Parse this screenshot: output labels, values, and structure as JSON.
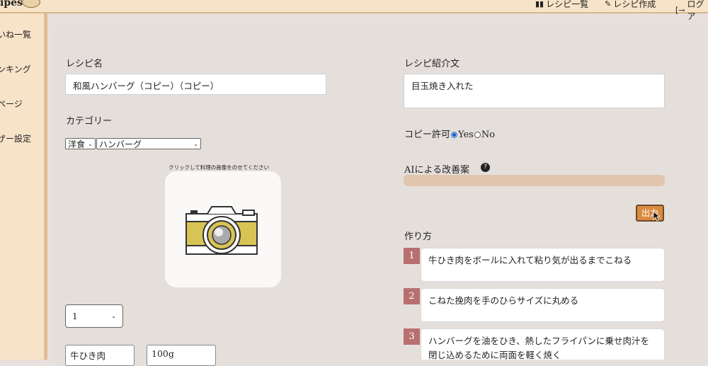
{
  "header": {
    "logo_text": "ipes",
    "nav": [
      {
        "label": "レシピ一覧"
      },
      {
        "label": "レシピ作成"
      },
      {
        "label": "ログア"
      }
    ]
  },
  "sidebar": {
    "items": [
      {
        "label": "いね一覧"
      },
      {
        "label": "ンキング"
      },
      {
        "label": "ページ"
      },
      {
        "label": "ザー設定"
      }
    ]
  },
  "form": {
    "recipe_name_label": "レシピ名",
    "recipe_name_value": "和風ハンバーグ（コピー）（コピー）",
    "category_label": "カテゴリー",
    "category_main": "洋食",
    "category_sub": "ハンバーグ",
    "photo_caption": "クリックして料理の画像をのせてください",
    "servings_value": "1",
    "ingredient_name": "牛ひき肉",
    "ingredient_amount": "100g",
    "intro_label": "レシピ紹介文",
    "intro_value": "目玉焼き入れた",
    "copy_permission_label": "コピー許可",
    "copy_yes": "Yes",
    "copy_no": "No",
    "ai_label": "AIによる改善案",
    "help_glyph": "?",
    "output_button": "出力",
    "steps_label": "作り方",
    "steps": [
      {
        "num": "1",
        "text": "牛ひき肉をボールに入れて粘り気が出るまでこねる"
      },
      {
        "num": "2",
        "text": "こねた挽肉を手のひらサイズに丸める"
      },
      {
        "num": "3",
        "text": "ハンバーグを油をひき、熱したフライパンに乗せ肉汁を閉じ込めるために両面を軽く焼く"
      }
    ]
  },
  "colors": {
    "header_bg": "#f7e3c8",
    "panel_bg": "#e5dfdc",
    "accent_step": "#b86f6f",
    "output_button": "#d98b3e",
    "ai_bar": "#e0c6ad"
  }
}
